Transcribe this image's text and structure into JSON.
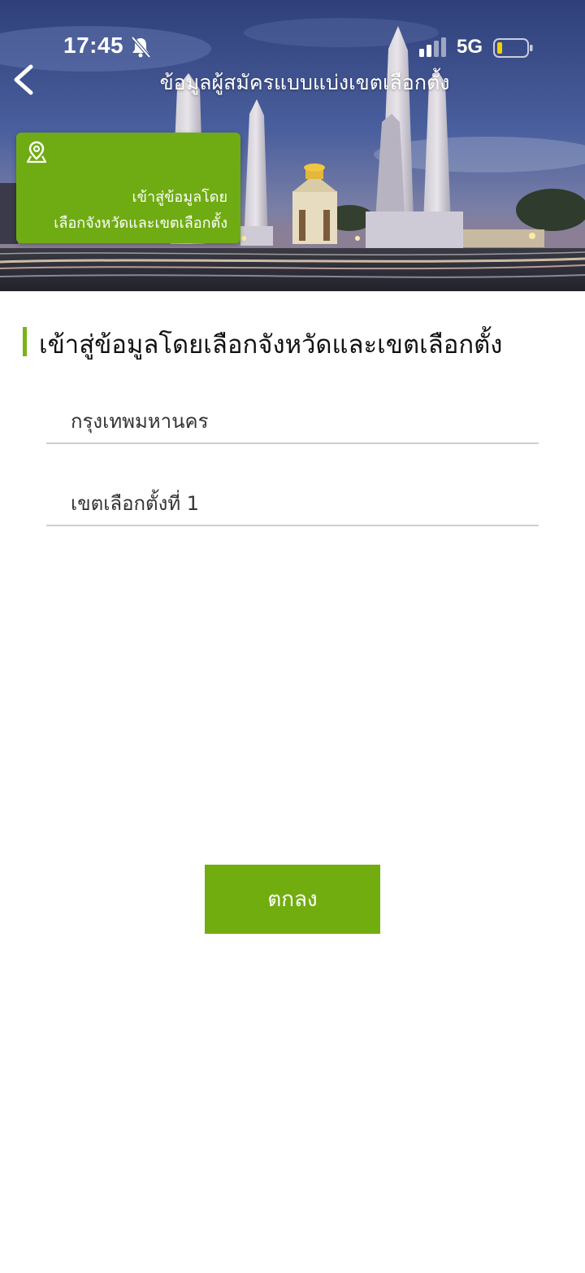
{
  "status_bar": {
    "time": "17:45",
    "network": "5G",
    "icons": [
      "bell-muted-icon",
      "signal-icon",
      "battery-icon"
    ]
  },
  "nav": {
    "title": "ข้อมูลผู้สมัครแบบแบ่งเขตเลือกตั้ง",
    "back_icon": "chevron-left-icon"
  },
  "hero_card": {
    "icon": "map-pin-icon",
    "line1": "เข้าสู่ข้อมูลโดย",
    "line2": "เลือกจังหวัดและเขตเลือกตั้ง"
  },
  "section": {
    "title": "เข้าสู่ข้อมูลโดยเลือกจังหวัดและเขตเลือกตั้ง"
  },
  "form": {
    "province_value": "กรุงเทพมหานคร",
    "district_value": "เขตเลือกตั้งที่ 1"
  },
  "confirm_button": {
    "label": "ตกลง"
  },
  "colors": {
    "accent_green": "#72ad10",
    "card_green": "#6fac13",
    "divider": "#cfcfcf"
  }
}
